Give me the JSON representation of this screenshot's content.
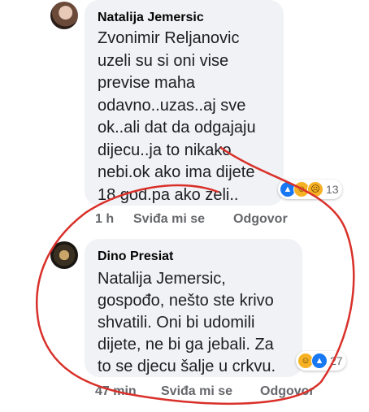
{
  "comments": [
    {
      "author": "Natalija Jemersic",
      "lines": [
        "Zvonimir Reljanovic",
        "uzeli su si oni vise",
        "previse maha",
        "odavno..uzas..aj sve",
        "ok..ali dat da odgajaju",
        "dijecu..ja to nikako",
        "nebi.ok ako ima dijete",
        "18 god.pa ako zeli.."
      ],
      "time": "1 h",
      "like_label": "Sviđa mi se",
      "reply_label": "Odgovor",
      "reaction_count": "13",
      "reaction_icons": [
        "like-icon",
        "haha-icon",
        "sad-icon"
      ]
    },
    {
      "author": "Dino Presiat",
      "lines": [
        "Natalija Jemersic,",
        "gospođo, nešto ste krivo",
        "shvatili. Oni bi udomili",
        "dijete, ne bi ga jebali. Za",
        "to se djecu šalje u crkvu."
      ],
      "time": "47 min",
      "like_label": "Sviđa mi se",
      "reply_label": "Odgovor",
      "reaction_count": "27",
      "reaction_icons": [
        "haha-icon",
        "like-icon"
      ]
    }
  ],
  "colors": {
    "annotation_circle": "#d9302a",
    "like": "#1877f2",
    "haha": "#f7b125"
  }
}
